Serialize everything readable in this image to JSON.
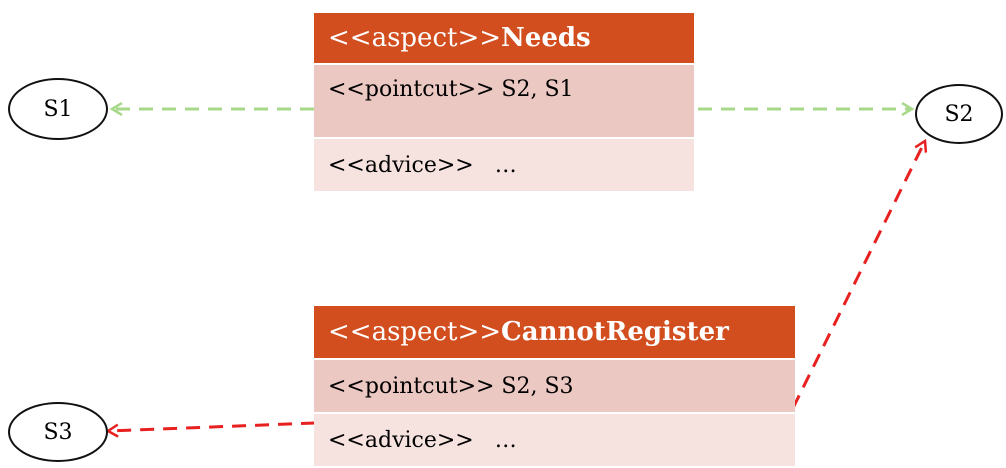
{
  "colors": {
    "header": "#d24e1f",
    "pointcut_row": "#ecc8c3",
    "advice_row": "#f6e3e0",
    "green_arrow": "#a8d98a",
    "red_arrow": "#e82020",
    "state_border": "#111111"
  },
  "states": {
    "s1": "S1",
    "s2": "S2",
    "s3": "S3"
  },
  "aspects": [
    {
      "stereotype": "<<aspect>>",
      "name": "Needs",
      "pointcut": "<<pointcut>> S2, S1",
      "advice": "<<advice>>   …"
    },
    {
      "stereotype": "<<aspect>>",
      "name": "CannotRegister",
      "pointcut": "<<pointcut>> S2, S3",
      "advice": "<<advice>>   …"
    }
  ]
}
